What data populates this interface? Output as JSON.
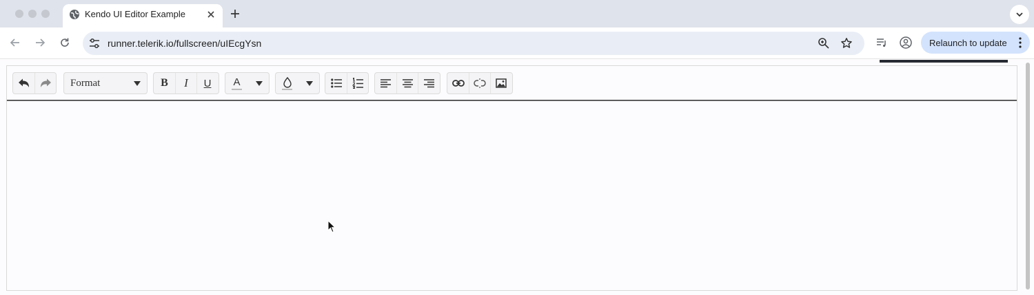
{
  "browser": {
    "tab_title": "Kendo UI Editor Example",
    "url": "runner.telerik.io/fullscreen/uIEcgYsn",
    "relaunch_label": "Relaunch to update",
    "icons": [
      "globe-icon",
      "close-icon",
      "plus-icon",
      "chevron-down-icon",
      "back-icon",
      "forward-icon",
      "reload-icon",
      "tune-icon",
      "zoom-icon",
      "star-icon",
      "media-icon",
      "profile-icon",
      "more-vert-icon"
    ]
  },
  "editor": {
    "format_value": "Format",
    "buttons": {
      "bold": "B",
      "italic": "I",
      "underline": "U",
      "fore_color": "A"
    },
    "tool_icons": [
      "undo-icon",
      "redo-icon",
      "bold-icon",
      "italic-icon",
      "underline-icon",
      "fore-color-icon",
      "back-color-icon",
      "bullet-list-icon",
      "numbered-list-icon",
      "align-left-icon",
      "align-center-icon",
      "align-right-icon",
      "link-icon",
      "unlink-icon",
      "image-icon"
    ],
    "content": ""
  }
}
